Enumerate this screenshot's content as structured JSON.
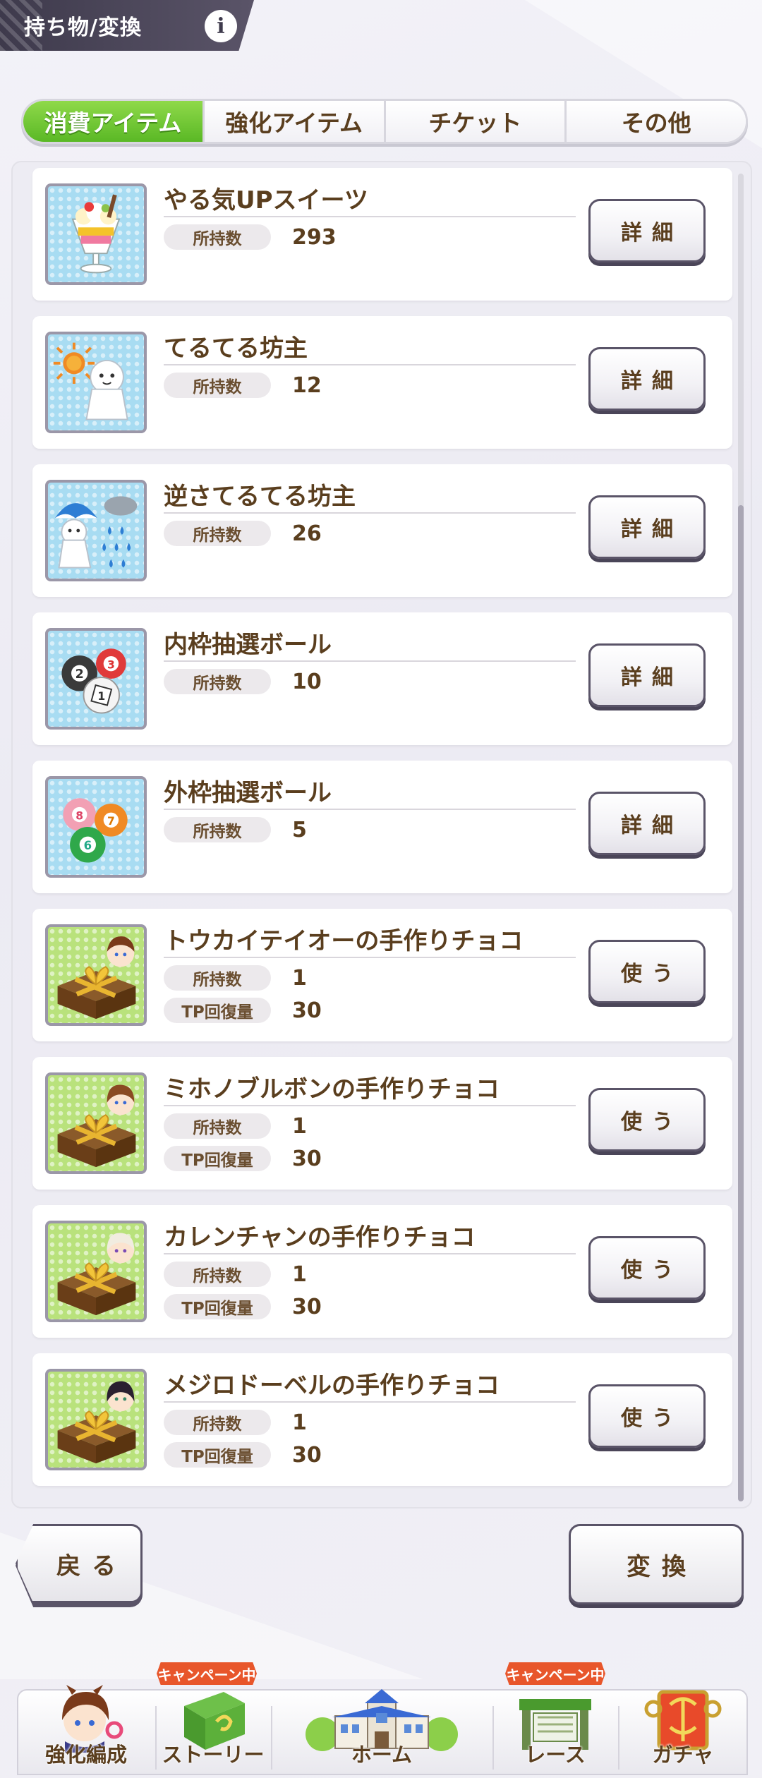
{
  "header": {
    "title": "持ち物/変換",
    "info_icon": "info-icon"
  },
  "tabs": [
    {
      "label": "消費アイテム",
      "active": true
    },
    {
      "label": "強化アイテム",
      "active": false
    },
    {
      "label": "チケット",
      "active": false
    },
    {
      "label": "その他",
      "active": false
    }
  ],
  "items": [
    {
      "name": "やる気UPスイーツ",
      "icon": "parfait-icon",
      "stats": [
        {
          "label": "所持数",
          "value": "293"
        }
      ],
      "button": "詳細"
    },
    {
      "name": "てるてる坊主",
      "icon": "teru-teru-bozu-sun-icon",
      "stats": [
        {
          "label": "所持数",
          "value": "12"
        }
      ],
      "button": "詳細"
    },
    {
      "name": "逆さてるてる坊主",
      "icon": "teru-teru-bozu-rain-icon",
      "stats": [
        {
          "label": "所持数",
          "value": "26"
        }
      ],
      "button": "詳細"
    },
    {
      "name": "内枠抽選ボール",
      "icon": "inner-lottery-balls-icon",
      "stats": [
        {
          "label": "所持数",
          "value": "10"
        }
      ],
      "button": "詳細"
    },
    {
      "name": "外枠抽選ボール",
      "icon": "outer-lottery-balls-icon",
      "stats": [
        {
          "label": "所持数",
          "value": "5"
        }
      ],
      "button": "詳細"
    },
    {
      "name": "トウカイテイオーの手作りチョコ",
      "icon": "chocolate-gift-icon",
      "stats": [
        {
          "label": "所持数",
          "value": "1"
        },
        {
          "label": "TP回復量",
          "value": "30"
        }
      ],
      "button": "使う"
    },
    {
      "name": "ミホノブルボンの手作りチョコ",
      "icon": "chocolate-gift-icon",
      "stats": [
        {
          "label": "所持数",
          "value": "1"
        },
        {
          "label": "TP回復量",
          "value": "30"
        }
      ],
      "button": "使う"
    },
    {
      "name": "カレンチャンの手作りチョコ",
      "icon": "chocolate-gift-icon",
      "stats": [
        {
          "label": "所持数",
          "value": "1"
        },
        {
          "label": "TP回復量",
          "value": "30"
        }
      ],
      "button": "使う"
    },
    {
      "name": "メジロドーベルの手作りチョコ",
      "icon": "chocolate-gift-icon",
      "stats": [
        {
          "label": "所持数",
          "value": "1"
        },
        {
          "label": "TP回復量",
          "value": "30"
        }
      ],
      "button": "使う"
    }
  ],
  "ball_numbers": {
    "inner": [
      "2",
      "3",
      "1"
    ],
    "outer": [
      "8",
      "7",
      "6"
    ]
  },
  "footer": {
    "back": "戻る",
    "convert": "変換"
  },
  "nav": {
    "items": [
      {
        "label": "強化編成",
        "badge": ""
      },
      {
        "label": "ストーリー",
        "badge": "キャンペーン中"
      },
      {
        "label": "ホーム",
        "badge": ""
      },
      {
        "label": "レース",
        "badge": "キャンペーン中"
      },
      {
        "label": "ガチャ",
        "badge": ""
      }
    ]
  },
  "colors": {
    "accent_green": "#5ab825",
    "text_brown": "#5a3e1e",
    "header_dark": "#3e3a4c",
    "campaign_orange": "#e8562b"
  }
}
